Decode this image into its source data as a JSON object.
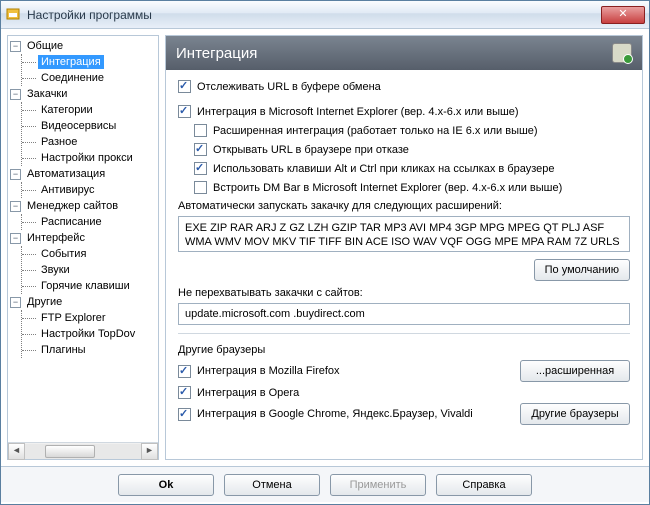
{
  "window": {
    "title": "Настройки программы"
  },
  "tree": {
    "general": {
      "label": "Общие",
      "integration": "Интеграция",
      "connection": "Соединение"
    },
    "downloads": {
      "label": "Закачки",
      "categories": "Категории",
      "videoservices": "Видеосервисы",
      "other": "Разное",
      "proxy": "Настройки прокси"
    },
    "automation": {
      "label": "Автоматизация",
      "antivirus": "Антивирус"
    },
    "sitemanager": {
      "label": "Менеджер сайтов",
      "schedule": "Расписание"
    },
    "interface": {
      "label": "Интерфейс",
      "events": "События",
      "sounds": "Звуки",
      "hotkeys": "Горячие клавиши"
    },
    "others": {
      "label": "Другие",
      "ftp": "FTP Explorer",
      "topdov": "Настройки TopDov",
      "plugins": "Плагины"
    }
  },
  "panel": {
    "title": "Интеграция",
    "monitor_clipboard": "Отслеживать URL в буфере обмена",
    "ie_integration": "Интеграция в Microsoft Internet Explorer (вер. 4.x-6.x или выше)",
    "ie_advanced": "Расширенная интеграция (работает только на IE 6.x или выше)",
    "ie_open_on_fail": "Открывать URL в браузере при отказе",
    "ie_altctrl": "Использовать клавиши Alt и Ctrl при кликах на ссылках в браузере",
    "ie_dmbar": "Встроить DM Bar в Microsoft Internet Explorer (вер. 4.x-6.x или выше)",
    "auto_ext_label": "Автоматически запускать закачку для следующих расширений:",
    "extensions": "EXE ZIP RAR ARJ Z GZ LZH GZIP TAR MP3 AVI MP4 3GP MPG MPEG QT PLJ ASF WMA WMV MOV MKV TIF TIFF BIN ACE ISO WAV VQF OGG MPE MPA RAM 7Z URLS",
    "default_btn": "По умолчанию",
    "skip_label": "Не перехватывать закачки с сайтов:",
    "skip_sites": "update.microsoft.com .buydirect.com",
    "other_browsers_title": "Другие браузеры",
    "firefox": "Интеграция в Mozilla Firefox",
    "opera": "Интеграция в Opera",
    "chrome": "Интеграция в Google Chrome, Яндекс.Браузер, Vivaldi",
    "advanced_btn": "...расширенная",
    "other_btn": "Другие браузеры"
  },
  "footer": {
    "ok": "Ok",
    "cancel": "Отмена",
    "apply": "Применить",
    "help": "Справка"
  }
}
